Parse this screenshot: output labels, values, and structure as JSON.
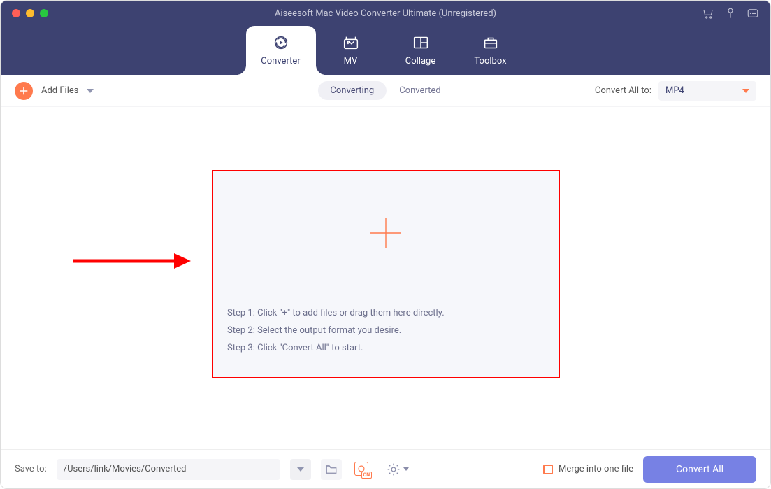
{
  "title": "Aiseesoft Mac Video Converter Ultimate (Unregistered)",
  "tabs": {
    "converter": "Converter",
    "mv": "MV",
    "collage": "Collage",
    "toolbox": "Toolbox"
  },
  "toolbar": {
    "add_files_label": "Add Files",
    "converting_label": "Converting",
    "converted_label": "Converted",
    "convert_all_to_label": "Convert All to:",
    "format_selected": "MP4"
  },
  "dropzone": {
    "step1": "Step 1: Click \"+\" to add files or drag them here directly.",
    "step2": "Step 2: Select the output format you desire.",
    "step3": "Step 3: Click \"Convert All\" to start."
  },
  "bottombar": {
    "save_to_label": "Save to:",
    "save_path": "/Users/link/Movies/Converted",
    "merge_label": "Merge into one file",
    "convert_all_button": "Convert All",
    "gpu_badge": "ON"
  }
}
